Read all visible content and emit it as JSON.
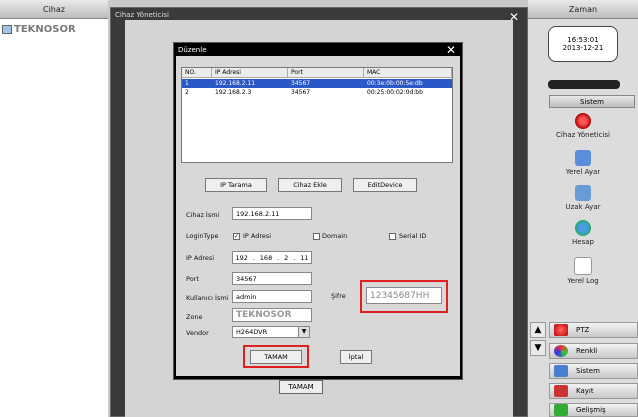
{
  "left_panel": {
    "title": "Cihaz",
    "tree_item": "TEKNOSOR"
  },
  "outer_window": {
    "title": "Cihaz Yöneticisi",
    "ok_label": "TAMAM"
  },
  "dialog": {
    "title": "Düzenle",
    "columns": [
      "NO.",
      "IP Adresi",
      "Port",
      "MAC"
    ],
    "rows": [
      {
        "no": "1",
        "ip": "192.168.2.11",
        "port": "34567",
        "mac": "00:3e:0b:00:5e:db"
      },
      {
        "no": "2",
        "ip": "192.168.2.3",
        "port": "34567",
        "mac": "00:25:00:02:0d:bb"
      }
    ],
    "selected_row": 0,
    "buttons": {
      "ip_scan": "IP Tarama",
      "add_device": "Cihaz Ekle",
      "edit_device": "EditDevice"
    },
    "form": {
      "device_name_label": "Cihaz İsmi",
      "device_name_value": "192.168.2.11",
      "login_type_label": "LoginType",
      "login_opt_ip": "IP Adresi",
      "login_opt_domain": "Domain",
      "login_opt_serial": "Serial ID",
      "login_ip_checked": true,
      "ip_label": "IP Adresi",
      "ip_parts": [
        "192",
        "168",
        "2",
        "11"
      ],
      "port_label": "Port",
      "port_value": "34567",
      "user_label": "Kullanıcı İsmi",
      "user_value": "admin",
      "password_label": "Şifre",
      "password_value": "12345687HH",
      "zone_label": "Zone",
      "zone_value": "TEKNOSOR",
      "vendor_label": "Vendor",
      "vendor_value": "H264DVR"
    },
    "ok_label": "TAMAM",
    "cancel_label": "İptal"
  },
  "right_panel": {
    "title": "Zaman",
    "time": "16:53:01",
    "date": "2013-12-21",
    "system_header": "Sistem",
    "items": [
      "Cihaz Yöneticisi",
      "Yerel Ayar",
      "Uzak Ayar",
      "Hesap",
      "Yerel Log"
    ],
    "menu": [
      "PTZ",
      "Renkli",
      "Sistem",
      "Kayıt",
      "Gelişmiş"
    ],
    "colors": {
      "red": "#e02020",
      "selection": "#2a58c6"
    }
  }
}
